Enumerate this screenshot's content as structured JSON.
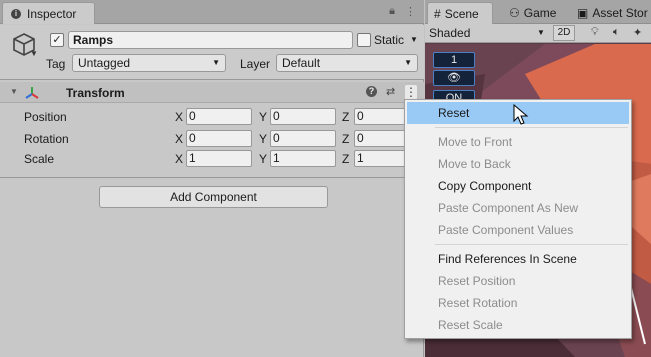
{
  "inspector": {
    "tab_label": "Inspector",
    "object": {
      "name": "Ramps",
      "active": true,
      "static_label": "Static",
      "tag_label": "Tag",
      "tag_value": "Untagged",
      "layer_label": "Layer",
      "layer_value": "Default"
    },
    "transform": {
      "title": "Transform",
      "rows": [
        {
          "label": "Position",
          "x": "0",
          "y": "0",
          "z": "0"
        },
        {
          "label": "Rotation",
          "x": "0",
          "y": "0",
          "z": "0"
        },
        {
          "label": "Scale",
          "x": "1",
          "y": "1",
          "z": "1"
        }
      ],
      "axis_labels": {
        "x": "X",
        "y": "Y",
        "z": "Z"
      }
    },
    "add_component_label": "Add Component"
  },
  "scene_panel": {
    "tabs": [
      {
        "label": "Scene",
        "icon": "hash-icon"
      },
      {
        "label": "Game",
        "icon": "gamepad-icon"
      },
      {
        "label": "Asset Stor",
        "icon": "bag-icon"
      }
    ],
    "shading_mode": "Shaded",
    "toggle_2d": "2D",
    "overlay_count": "1",
    "overlay_on": "ON"
  },
  "context_menu": {
    "items": [
      {
        "label": "Reset",
        "enabled": true,
        "highlighted": true
      },
      {
        "separator": true
      },
      {
        "label": "Move to Front",
        "enabled": false
      },
      {
        "label": "Move to Back",
        "enabled": false
      },
      {
        "label": "Copy Component",
        "enabled": true
      },
      {
        "label": "Paste Component As New",
        "enabled": false
      },
      {
        "label": "Paste Component Values",
        "enabled": false
      },
      {
        "separator": true
      },
      {
        "label": "Find References In Scene",
        "enabled": true
      },
      {
        "label": "Reset Position",
        "enabled": false
      },
      {
        "label": "Reset Rotation",
        "enabled": false
      },
      {
        "label": "Reset Scale",
        "enabled": false
      }
    ]
  },
  "colors": {
    "menu_highlight": "#99c9f5",
    "scene_background": "#5b3c45",
    "scene_orange": "#d96a4e"
  }
}
